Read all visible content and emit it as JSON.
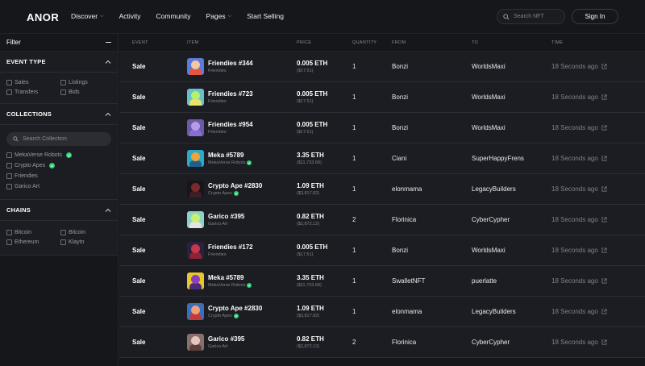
{
  "header": {
    "logo": "ANOR",
    "nav": [
      {
        "label": "Discover",
        "dropdown": true
      },
      {
        "label": "Activity",
        "dropdown": false
      },
      {
        "label": "Community",
        "dropdown": false
      },
      {
        "label": "Pages",
        "dropdown": true
      },
      {
        "label": "Start Selling",
        "dropdown": false
      }
    ],
    "search_placeholder": "Search NFT",
    "signin_label": "Sign In"
  },
  "sidebar": {
    "title": "Filter",
    "event_type": {
      "title": "EVENT TYPE",
      "options": [
        "Sales",
        "Listings",
        "Transfers",
        "Bids"
      ]
    },
    "collections": {
      "title": "COLLECTIONS",
      "search_placeholder": "Search Collection",
      "items": [
        {
          "label": "MekaVerse Robots",
          "verified": true
        },
        {
          "label": "Crypto Apes",
          "verified": true
        },
        {
          "label": "Friendies",
          "verified": false
        },
        {
          "label": "Garico Art",
          "verified": false
        }
      ]
    },
    "chains": {
      "title": "CHAINS",
      "options": [
        "Bitcoin",
        "Bitcoin",
        "Ethereum",
        "Klaytn"
      ]
    }
  },
  "table": {
    "columns": [
      "Event",
      "Item",
      "Price",
      "Quantity",
      "From",
      "To",
      "Time"
    ],
    "rows": [
      {
        "event": "Sale",
        "name": "Friendies #344",
        "collection": "Friendies",
        "verified": false,
        "eth": "0.005 ETH",
        "usd": "($17.51)",
        "qty": "1",
        "from": "Bonzi",
        "to": "WorldsMaxi",
        "time": "18 Seconds ago",
        "thumb": {
          "bg": "#5b7bd6",
          "fg": "#f2c7a3",
          "body": "#e8553f"
        }
      },
      {
        "event": "Sale",
        "name": "Friendies #723",
        "collection": "Friendies",
        "verified": false,
        "eth": "0.005 ETH",
        "usd": "($17.51)",
        "qty": "1",
        "from": "Bonzi",
        "to": "WorldsMaxi",
        "time": "18 Seconds ago",
        "thumb": {
          "bg": "#66c0c9",
          "fg": "#b7f06a",
          "body": "#e9e36a"
        }
      },
      {
        "event": "Sale",
        "name": "Friendies #954",
        "collection": "Friendies",
        "verified": false,
        "eth": "0.005 ETH",
        "usd": "($17.51)",
        "qty": "1",
        "from": "Bonzi",
        "to": "WorldsMaxi",
        "time": "18 Seconds ago",
        "thumb": {
          "bg": "#6c5aa8",
          "fg": "#b89ae8",
          "body": "#8a6fd1"
        }
      },
      {
        "event": "Sale",
        "name": "Meka #5789",
        "collection": "MekaVerse Robots",
        "verified": true,
        "eth": "3.35 ETH",
        "usd": "($11,733.68)",
        "qty": "1",
        "from": "Ciani",
        "to": "SuperHappyFrens",
        "time": "18 Seconds ago",
        "thumb": {
          "bg": "#2fa7c9",
          "fg": "#f0a33b",
          "body": "#1f5f8b"
        }
      },
      {
        "event": "Sale",
        "name": "Crypto Ape #2830",
        "collection": "Crypto Apes",
        "verified": true,
        "eth": "1.09 ETH",
        "usd": "($3,817.82)",
        "qty": "1",
        "from": "elonmama",
        "to": "LegacyBuilders",
        "time": "18 Seconds ago",
        "thumb": {
          "bg": "#1a1418",
          "fg": "#7a2a2e",
          "body": "#3b1f24"
        }
      },
      {
        "event": "Sale",
        "name": "Garico #395",
        "collection": "Garico Art",
        "verified": false,
        "eth": "0.82 ETH",
        "usd": "($2,872.12)",
        "qty": "2",
        "from": "Florinica",
        "to": "CyberCypher",
        "time": "18 Seconds ago",
        "thumb": {
          "bg": "#8fd1c7",
          "fg": "#c7f26b",
          "body": "#e2e2e2"
        }
      },
      {
        "event": "Sale",
        "name": "Friendies #172",
        "collection": "Friendies",
        "verified": false,
        "eth": "0.005 ETH",
        "usd": "($17.51)",
        "qty": "1",
        "from": "Bonzi",
        "to": "WorldsMaxi",
        "time": "18 Seconds ago",
        "thumb": {
          "bg": "#2a2140",
          "fg": "#c8364a",
          "body": "#8e2433"
        }
      },
      {
        "event": "Sale",
        "name": "Meka #5789",
        "collection": "MekaVerse Robots",
        "verified": true,
        "eth": "3.35 ETH",
        "usd": "($11,733.68)",
        "qty": "1",
        "from": "SwalletNFT",
        "to": "puerlatte",
        "time": "18 Seconds ago",
        "thumb": {
          "bg": "#e6c72e",
          "fg": "#8a3fc2",
          "body": "#4a2a7a"
        }
      },
      {
        "event": "Sale",
        "name": "Crypto Ape #2830",
        "collection": "Crypto Apes",
        "verified": true,
        "eth": "1.09 ETH",
        "usd": "($3,817.82)",
        "qty": "1",
        "from": "elonmama",
        "to": "LegacyBuilders",
        "time": "18 Seconds ago",
        "thumb": {
          "bg": "#3d6fb8",
          "fg": "#f0a07a",
          "body": "#c23a3a"
        }
      },
      {
        "event": "Sale",
        "name": "Garico #395",
        "collection": "Garico Art",
        "verified": false,
        "eth": "0.82 ETH",
        "usd": "($2,872.12)",
        "qty": "2",
        "from": "Florinica",
        "to": "CyberCypher",
        "time": "18 Seconds ago",
        "thumb": {
          "bg": "#8a6f6a",
          "fg": "#e7c6c0",
          "body": "#5b3f3b"
        }
      }
    ]
  }
}
